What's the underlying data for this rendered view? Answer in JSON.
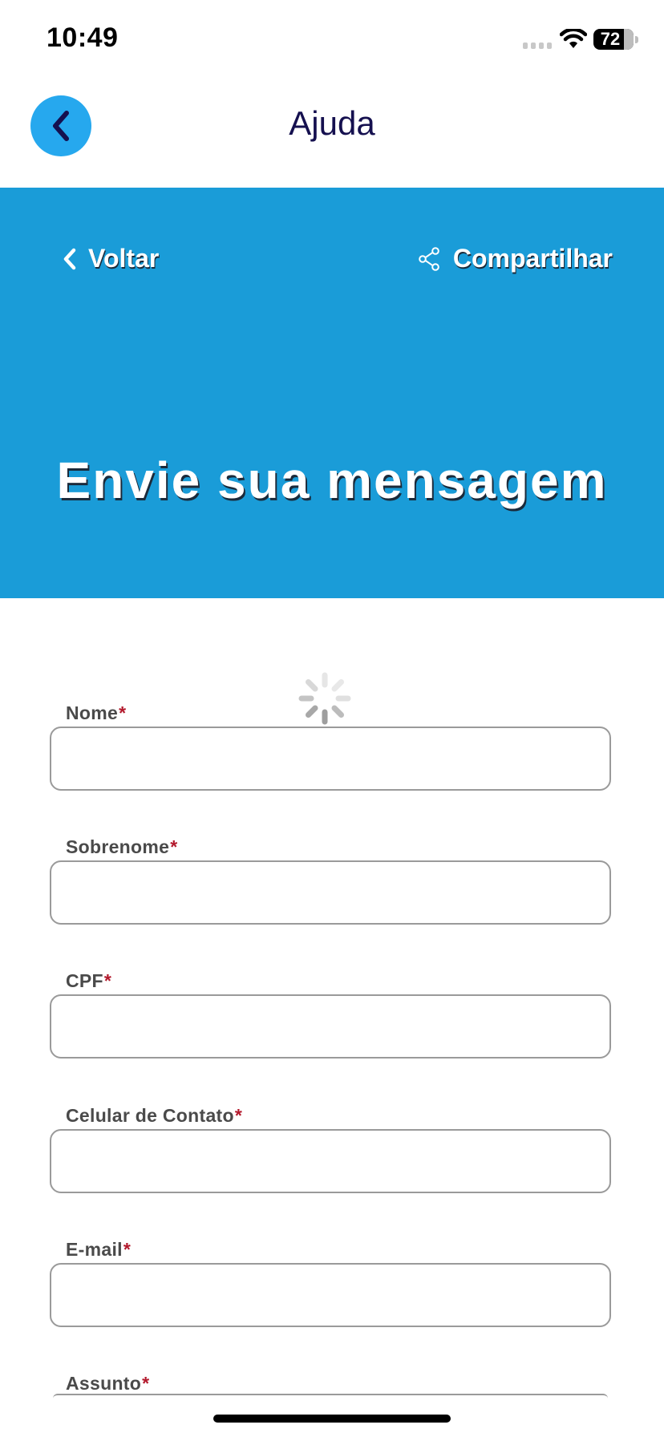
{
  "status_bar": {
    "time": "10:49",
    "battery_level": "72"
  },
  "nav": {
    "title": "Ajuda"
  },
  "hero": {
    "back_label": "Voltar",
    "share_label": "Compartilhar",
    "title": "Envie sua mensagem",
    "background_color": "#1a9cd8"
  },
  "form": {
    "required_marker": "*",
    "fields": [
      {
        "label": "Nome",
        "value": "",
        "placeholder": ""
      },
      {
        "label": "Sobrenome",
        "value": "",
        "placeholder": ""
      },
      {
        "label": "CPF",
        "value": "",
        "placeholder": ""
      },
      {
        "label": "Celular de Contato",
        "value": "",
        "placeholder": ""
      },
      {
        "label": "E-mail",
        "value": "",
        "placeholder": ""
      },
      {
        "label": "Assunto",
        "value": "",
        "placeholder": ""
      }
    ]
  },
  "colors": {
    "accent": "#26a8ee",
    "nav_title": "#15104f",
    "required": "#b3192c"
  }
}
